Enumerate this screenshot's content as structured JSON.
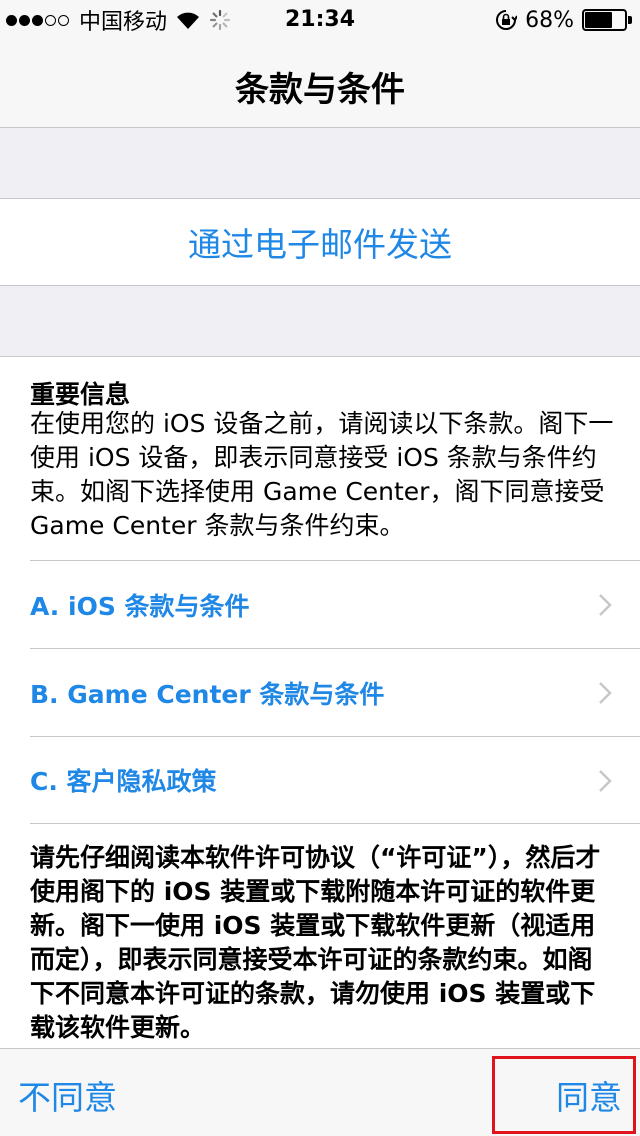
{
  "status_bar": {
    "carrier": "中国移动",
    "time": "21:34",
    "battery_percent": "68%",
    "battery_level": 0.68,
    "signal_filled": 3,
    "signal_total": 5
  },
  "nav": {
    "title": "条款与条件"
  },
  "email": {
    "label": "通过电子邮件发送"
  },
  "info": {
    "title": "重要信息",
    "body": "在使用您的 iOS 设备之前，请阅读以下条款。阁下一使用 iOS 设备，即表示同意接受 iOS 条款与条件约束。如阁下选择使用 Game Center，阁下同意接受 Game Center 条款与条件约束。"
  },
  "links": [
    {
      "label": "A. iOS 条款与条件"
    },
    {
      "label": "B. Game Center 条款与条件"
    },
    {
      "label": "C. 客户隐私政策"
    }
  ],
  "license": {
    "text": "请先仔细阅读本软件许可协议（“许可证”），然后才使用阁下的 iOS 装置或下载附随本许可证的软件更新。阁下一使用 iOS 装置或下载软件更新（视适用而定），即表示同意接受本许可证的条款约束。如阁下不同意本许可证的条款，请勿使用 iOS 装置或下载该软件更新。"
  },
  "toolbar": {
    "disagree": "不同意",
    "agree": "同意"
  },
  "colors": {
    "accent": "#1f87e5",
    "highlight": "#e0141e"
  }
}
